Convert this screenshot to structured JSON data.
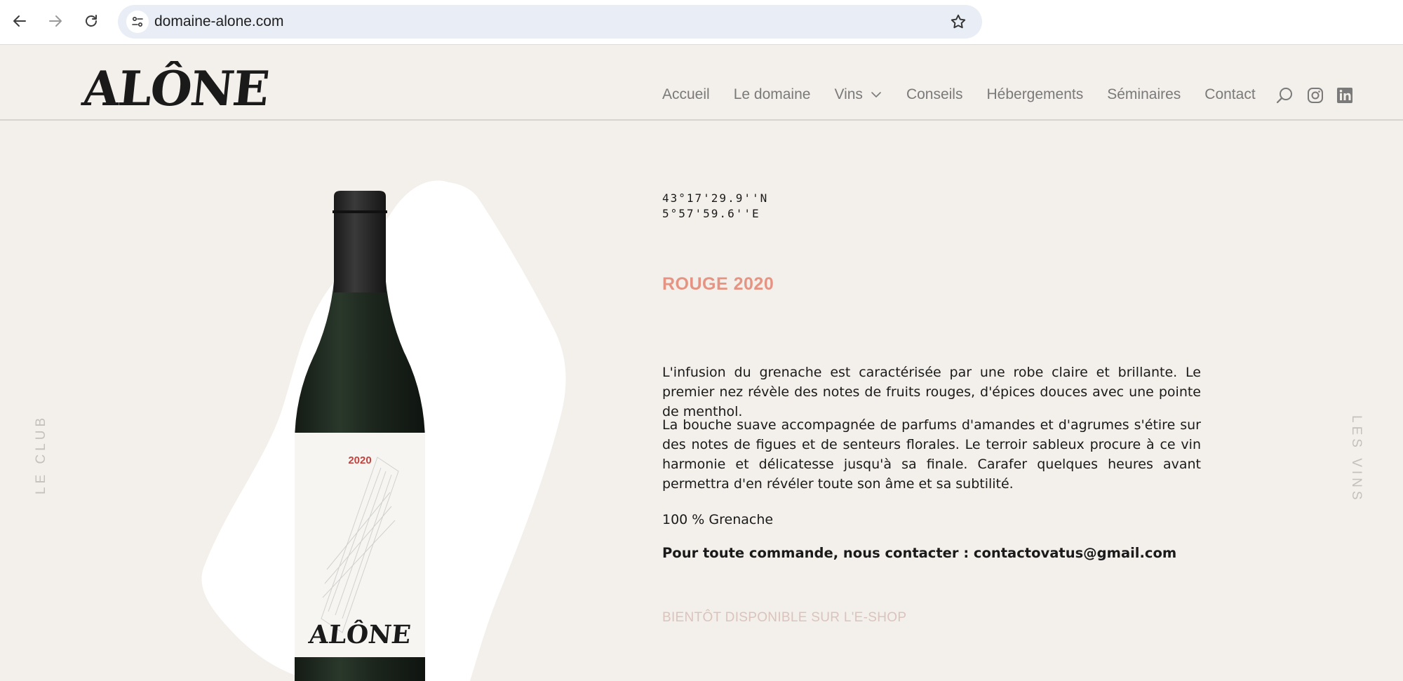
{
  "browser": {
    "url": "domaine-alone.com",
    "icons": {
      "back": "arrow-left-icon",
      "forward": "arrow-right-icon",
      "reload": "reload-icon",
      "site_info": "tune-icon",
      "bookmark": "star-icon"
    }
  },
  "header": {
    "logo_text": "ALÔNE",
    "nav": {
      "accueil": "Accueil",
      "le_domaine": "Le domaine",
      "vins": "Vins",
      "conseils": "Conseils",
      "hebergements": "Hébergements",
      "seminaires": "Séminaires",
      "contact": "Contact"
    },
    "icons": [
      "search-icon",
      "instagram-icon",
      "linkedin-icon"
    ]
  },
  "side": {
    "left": "LE CLUB",
    "right": "LES VINS"
  },
  "bottle": {
    "label_year": "2020",
    "label_logo": "ALÔNE"
  },
  "content": {
    "coords_lat": "43°17'29.9''N",
    "coords_lon": "5°57'59.6''E",
    "title": "ROUGE 2020",
    "paragraph_1": "L'infusion du grenache est caractérisée par une robe claire et brillante. Le premier nez révèle des notes de fruits rouges, d'épices douces avec une pointe de menthol.",
    "paragraph_2": "La bouche suave accompagnée de parfums d'amandes et d'agrumes s'étire sur des notes de figues et de senteurs florales. Le terroir sableux procure à ce vin harmonie et délicatesse jusqu'à sa finale. Carafer quelques heures avant permettra d'en révéler toute son âme et sa subtilité.",
    "grape": "100 % Grenache",
    "order": "Pour toute commande, nous contacter : contactovatus@gmail.com",
    "eshop": "BIENTÔT DISPONIBLE SUR L'E-SHOP"
  },
  "colors": {
    "page_bg": "#f3efea",
    "title_accent": "#e59483",
    "eshop_text": "#dbc3bd",
    "nav_text": "#7a7a7a",
    "bottle_glass": "#1f2a20"
  }
}
